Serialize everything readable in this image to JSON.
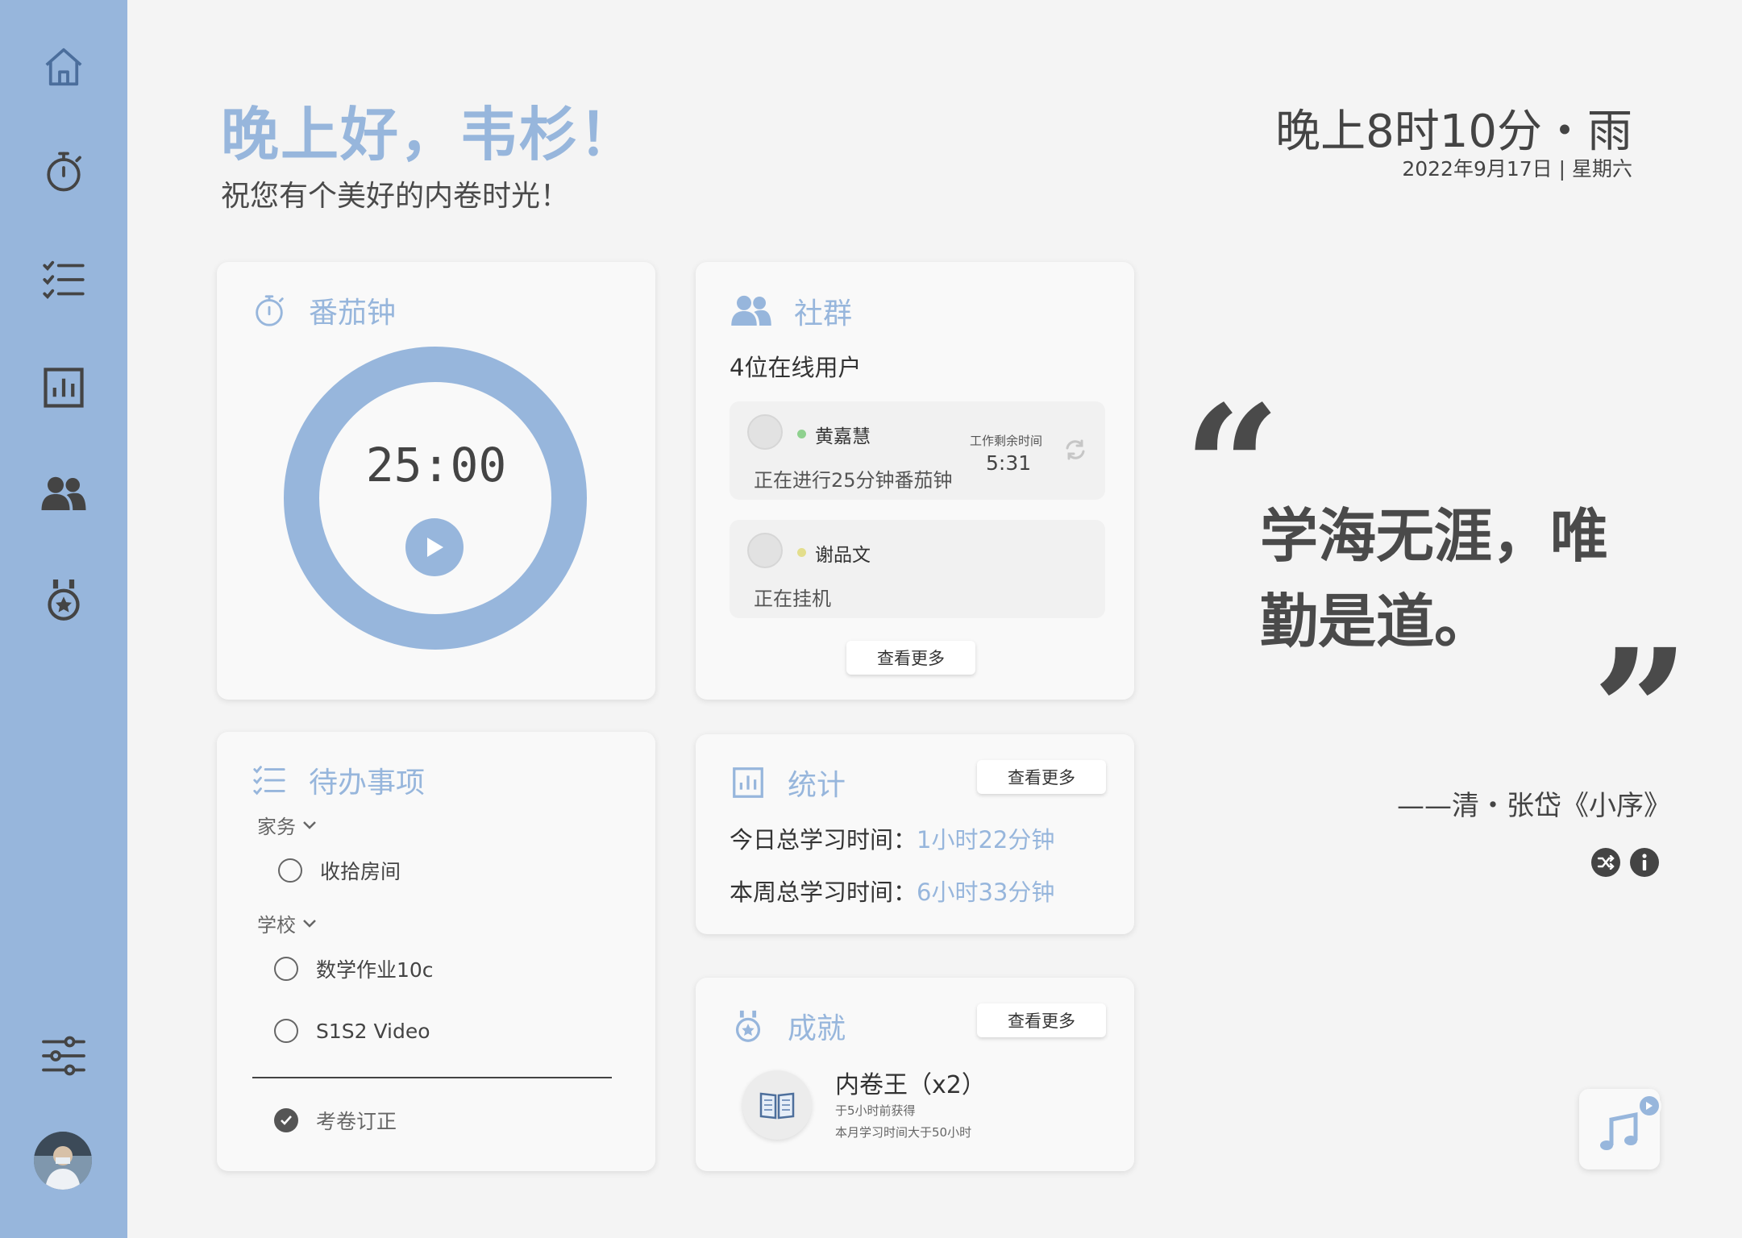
{
  "greeting": {
    "title": "晚上好，韦杉！",
    "subtitle": "祝您有个美好的内卷时光！"
  },
  "clock": {
    "time_weather": "晚上8时10分・雨",
    "date": "2022年9月17日 | 星期六"
  },
  "sidebar": {
    "items": [
      {
        "icon": "home-icon"
      },
      {
        "icon": "stopwatch-icon"
      },
      {
        "icon": "checklist-icon"
      },
      {
        "icon": "chart-icon"
      },
      {
        "icon": "users-icon"
      },
      {
        "icon": "medal-icon"
      }
    ],
    "settings_icon": "sliders-icon"
  },
  "pomodoro": {
    "title": "番茄钟",
    "timer": "25:00"
  },
  "community": {
    "title": "社群",
    "online_count": "4位在线用户",
    "users": [
      {
        "name": "黄嘉慧",
        "status": "正在进行25分钟番茄钟",
        "remaining_label": "工作剩余时间",
        "remaining": "5:31",
        "dot_color": "#8fd18f"
      },
      {
        "name": "谢品文",
        "status": "正在挂机",
        "dot_color": "#e3de8c"
      }
    ],
    "more": "查看更多"
  },
  "todo": {
    "title": "待办事项",
    "groups": [
      {
        "name": "家务",
        "items": [
          "收拾房间"
        ]
      },
      {
        "name": "学校",
        "items": [
          "数学作业10c",
          "S1S2 Video"
        ]
      }
    ],
    "done": [
      "考卷订正"
    ]
  },
  "stats": {
    "title": "统计",
    "more": "查看更多",
    "today_label": "今日总学习时间：",
    "today_value": "1小时22分钟",
    "week_label": "本周总学习时间：",
    "week_value": "6小时33分钟"
  },
  "achievement": {
    "title": "成就",
    "more": "查看更多",
    "name": "内卷王（x2）",
    "time": "于5小时前获得",
    "desc": "本月学习时间大于50小时"
  },
  "quote": {
    "text": "学海无涯，唯勤是道。",
    "source": "——清・张岱《小序》"
  },
  "colors": {
    "accent": "#97b6dc",
    "background": "#f4f4f4",
    "text": "#444444"
  }
}
